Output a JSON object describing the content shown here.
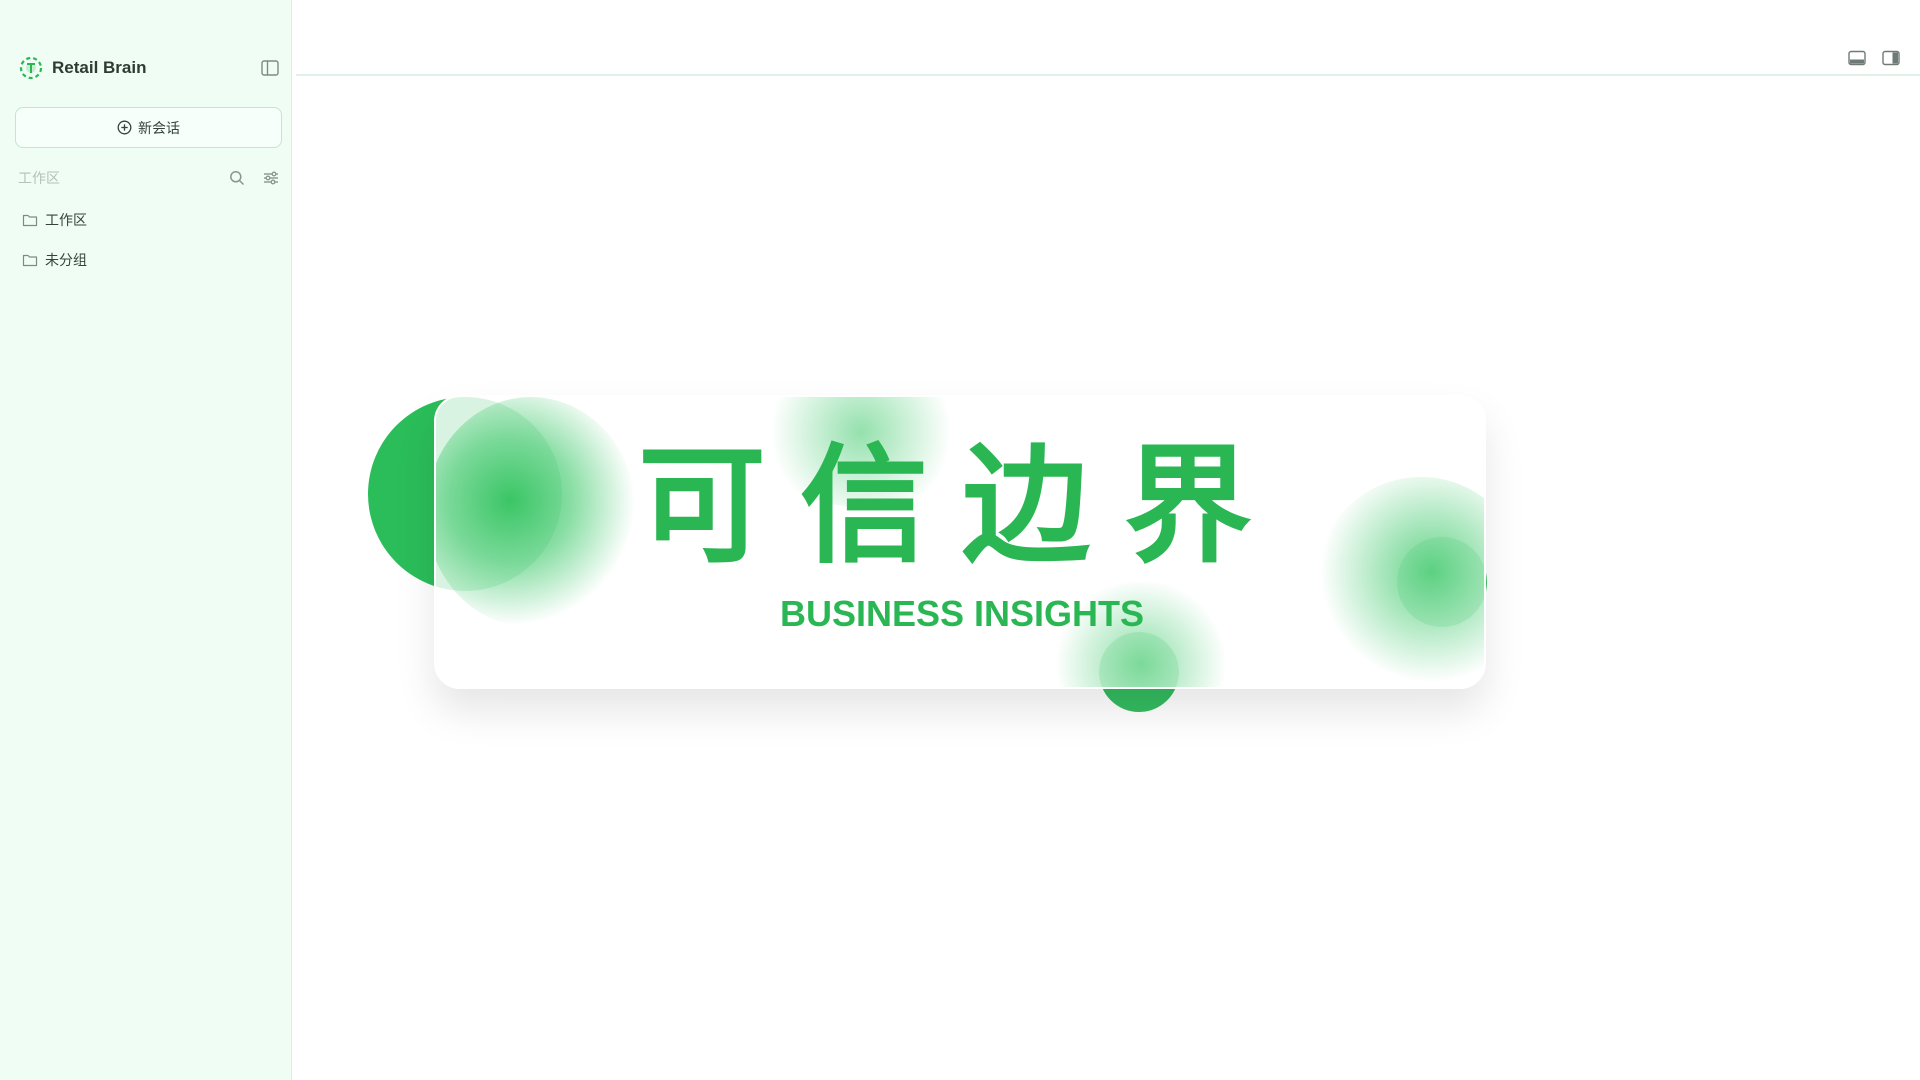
{
  "sidebar": {
    "brand_name": "Retail Brain",
    "new_chat_label": "新会话",
    "section_label": "工作区",
    "folders": [
      {
        "label": "工作区"
      },
      {
        "label": "未分组"
      }
    ]
  },
  "hero": {
    "title": "可信边界",
    "subtitle": "BUSINESS INSIGHTS"
  },
  "colors": {
    "accent": "#2bb654",
    "sidebar_bg": "#f0fdf5"
  },
  "icons": {
    "brand": "brand-logo-icon",
    "collapse": "sidebar-toggle-icon",
    "new_chat": "plus-circle-icon",
    "search": "search-icon",
    "filter": "sliders-icon",
    "folder": "folder-icon",
    "topbar": [
      "panel-bottom-icon",
      "panel-right-icon"
    ]
  }
}
